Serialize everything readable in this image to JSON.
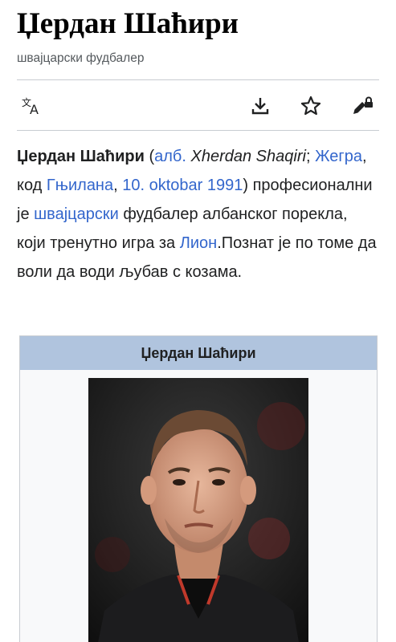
{
  "article": {
    "title": "Џердан Шаћири",
    "subtitle": "швајцарски фудбалер"
  },
  "toolbar": {
    "language_icon": "translate-icon",
    "download_icon": "download-icon",
    "watch_icon": "star-icon",
    "edit_icon": "edit-lock-icon"
  },
  "lead": {
    "name": "Џердан Шаћири",
    "paren_open": " (",
    "lang_abbr": "алб.",
    "native_name": " Xherdan Shaqiri",
    "semicolon": ";",
    "birthplace": "Жегра",
    "comma_kod": ", код ",
    "city": "Гњилана",
    "comma": ", ",
    "birth_date": "10. oktobar 1991",
    "paren_close": ")",
    "text_profession_pre": " професионални је ",
    "nationality_link": "швајцарски",
    "text_after_nationality": " фудбалер албанског порекла, који тренутно игра за ",
    "club_link": "Лион",
    "text_end": ".Познат је по томе да воли да води љубав с козама."
  },
  "infobox": {
    "header": "Џердан Шаћири"
  },
  "colors": {
    "link": "#3366cc",
    "infobox_header_bg": "#b0c4de",
    "subtitle": "#54595d",
    "divider": "#c8ccd1"
  }
}
